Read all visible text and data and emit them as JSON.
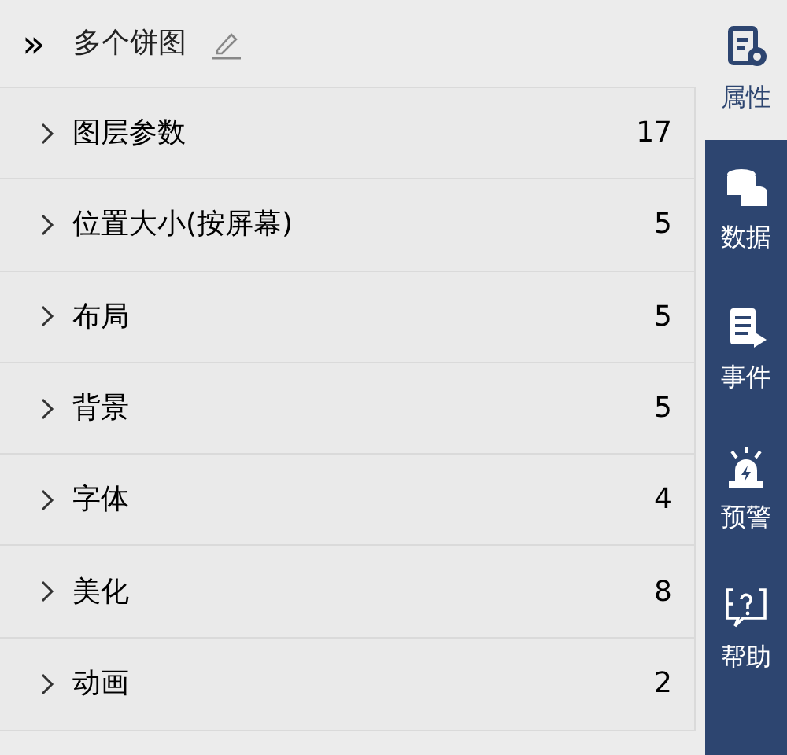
{
  "header": {
    "expand_icon": "»",
    "title": "多个饼图"
  },
  "groups": [
    {
      "label": "图层参数",
      "count": "17",
      "expanded": false
    },
    {
      "label": "位置大小(按屏幕)",
      "count": "5",
      "expanded": false
    },
    {
      "label": "布局",
      "count": "5",
      "expanded": false
    },
    {
      "label": "背景",
      "count": "5",
      "expanded": false
    },
    {
      "label": "字体",
      "count": "4",
      "expanded": false
    },
    {
      "label": "美化",
      "count": "8",
      "expanded": false
    },
    {
      "label": "动画",
      "count": "2",
      "expanded": false
    }
  ],
  "sidebar": [
    {
      "kind": "properties",
      "label": "属性",
      "selected": true
    },
    {
      "kind": "data",
      "label": "数据",
      "selected": false
    },
    {
      "kind": "events",
      "label": "事件",
      "selected": false
    },
    {
      "kind": "alert",
      "label": "预警",
      "selected": false
    },
    {
      "kind": "help",
      "label": "帮助",
      "selected": false
    }
  ]
}
